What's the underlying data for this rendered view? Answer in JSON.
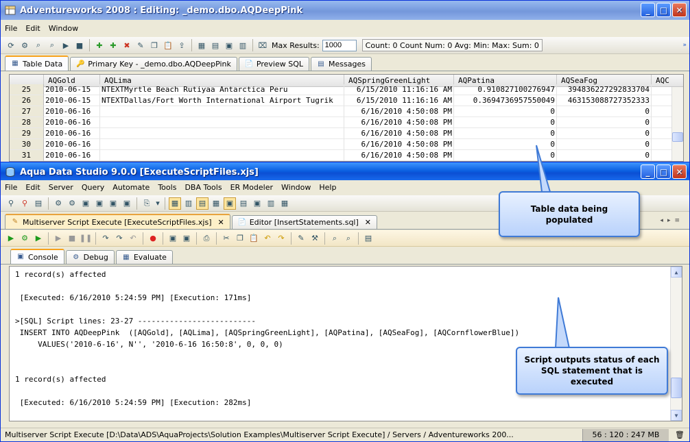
{
  "window1": {
    "title": "Adventureworks 2008 : Editing: _demo.dbo.AQDeepPink",
    "menu": [
      "File",
      "Edit",
      "Window"
    ],
    "max_results_label": "Max Results:",
    "max_results_value": "1000",
    "counts": "Count: 0  Count Num: 0  Avg:   Min:   Max:   Sum: 0",
    "tabs": [
      "Table Data",
      "Primary Key - _demo.dbo.AQDeepPink",
      "Preview SQL",
      "Messages"
    ],
    "columns": [
      "AQGold",
      "AQLima",
      "AQSpringGreenLight",
      "AQPatina",
      "AQSeaFog",
      "AQC"
    ],
    "rows": [
      {
        "n": "25",
        "gold": "2010-06-15",
        "lima": "NTEXTMyrtle Beach Rutiyaa Antarctica Peru",
        "spring": "6/15/2010 11:16:16 AM",
        "patina": "0.910827100276947",
        "seafog": "394836227292833704"
      },
      {
        "n": "26",
        "gold": "2010-06-15",
        "lima": "NTEXTDallas/Fort Worth International Airport Tugrik",
        "spring": "6/15/2010 11:16:16 AM",
        "patina": "0.3694736957550049",
        "seafog": "463153088727352333"
      },
      {
        "n": "27",
        "gold": "2010-06-16",
        "lima": "",
        "spring": "6/16/2010 4:50:08 PM",
        "patina": "0",
        "seafog": "0"
      },
      {
        "n": "28",
        "gold": "2010-06-16",
        "lima": "",
        "spring": "6/16/2010 4:50:08 PM",
        "patina": "0",
        "seafog": "0"
      },
      {
        "n": "29",
        "gold": "2010-06-16",
        "lima": "",
        "spring": "6/16/2010 4:50:08 PM",
        "patina": "0",
        "seafog": "0"
      },
      {
        "n": "30",
        "gold": "2010-06-16",
        "lima": "",
        "spring": "6/16/2010 4:50:08 PM",
        "patina": "0",
        "seafog": "0"
      },
      {
        "n": "31",
        "gold": "2010-06-16",
        "lima": "",
        "spring": "6/16/2010 4:50:08 PM",
        "patina": "0",
        "seafog": "0"
      }
    ]
  },
  "window2": {
    "title": "Aqua Data Studio 9.0.0 [ExecuteScriptFiles.xjs]",
    "menu": [
      "File",
      "Edit",
      "Server",
      "Query",
      "Automate",
      "Tools",
      "DBA Tools",
      "ER Modeler",
      "Window",
      "Help"
    ],
    "doc_tabs": [
      "Multiserver Script Execute [ExecuteScriptFiles.xjs]",
      "Editor [InsertStatements.sql]"
    ],
    "sub_tabs": [
      "Console",
      "Debug",
      "Evaluate"
    ],
    "console_lines": [
      "1 record(s) affected",
      "",
      " [Executed: 6/16/2010 5:24:59 PM] [Execution: 171ms]",
      "",
      ">[SQL] Script lines: 23-27 --------------------------",
      " INSERT INTO AQDeepPink  ([AQGold], [AQLima], [AQSpringGreenLight], [AQPatina], [AQSeaFog], [AQCornflowerBlue])",
      "     VALUES('2010-6-16', N'', '2010-6-16 16:50:8', 0, 0, 0)",
      "",
      "",
      "1 record(s) affected",
      "",
      " [Executed: 6/16/2010 5:24:59 PM] [Execution: 282ms]"
    ],
    "status_path": "Multiserver Script Execute [D:\\Data\\ADS\\AquaProjects\\Solution Examples\\Multiserver Script Execute] / Servers / Adventureworks 200...",
    "status_pos": "56 : 120 : 247 MB"
  },
  "callouts": {
    "table_data": "Table data being populated",
    "script_outputs": "Script outputs status of each SQL statement that is executed"
  },
  "colors": {
    "titlebar_active": "#0a5fe0",
    "accent_tab": "#f7a21c",
    "callout_border": "#3f7ad6"
  }
}
